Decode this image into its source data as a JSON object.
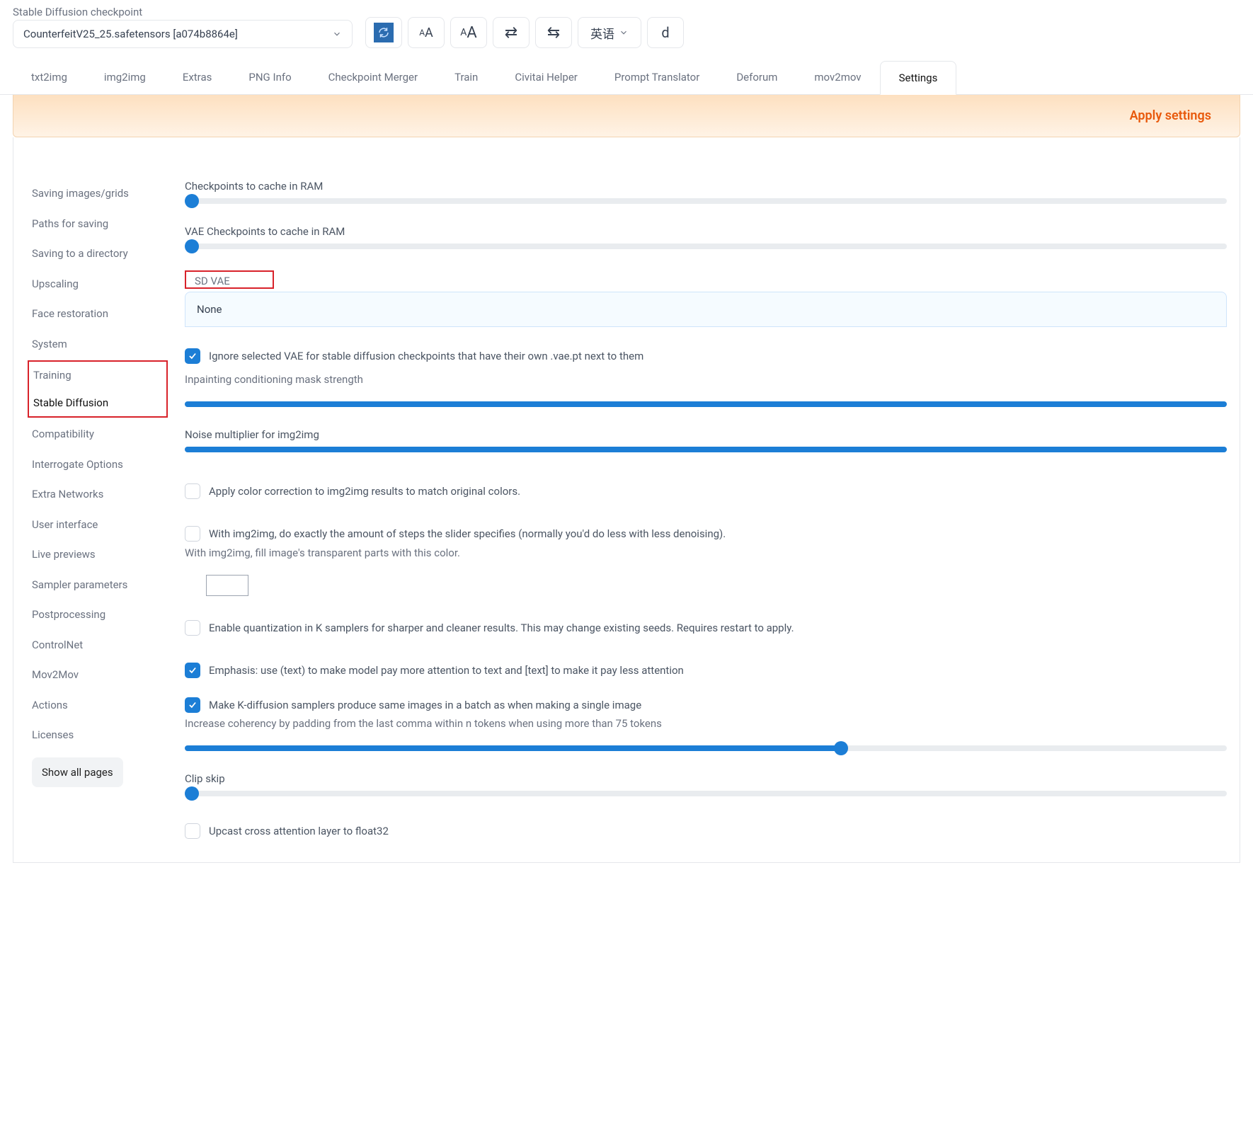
{
  "header": {
    "checkpoint_label": "Stable Diffusion checkpoint",
    "checkpoint_value": "CounterfeitV25_25.safetensors [a074b8864e]",
    "toolbar": {
      "refresh": "refresh",
      "font_small": "ᴀA",
      "font_large": "ᴀA",
      "swap": "⇄",
      "translate_toggle": "⇆",
      "language": "英语",
      "d": "d"
    }
  },
  "tabs": [
    "txt2img",
    "img2img",
    "Extras",
    "PNG Info",
    "Checkpoint Merger",
    "Train",
    "Civitai Helper",
    "Prompt Translator",
    "Deforum",
    "mov2mov",
    "Settings"
  ],
  "active_tab": "Settings",
  "apply_button": "Apply settings",
  "sidebar": {
    "items": [
      "Saving images/grids",
      "Paths for saving",
      "Saving to a directory",
      "Upscaling",
      "Face restoration",
      "System",
      "Training",
      "Stable Diffusion",
      "Compatibility",
      "Interrogate Options",
      "Extra Networks",
      "User interface",
      "Live previews",
      "Sampler parameters",
      "Postprocessing",
      "ControlNet",
      "Mov2Mov",
      "Actions",
      "Licenses"
    ],
    "active_index": 7,
    "show_all": "Show all pages"
  },
  "settings": {
    "ckpt_cache_label": "Checkpoints to cache in RAM",
    "ckpt_cache_fill_pct": 0,
    "vae_cache_label": "VAE Checkpoints to cache in RAM",
    "vae_cache_fill_pct": 0,
    "sd_vae_label": "SD VAE",
    "sd_vae_value": "None",
    "ignore_vae": {
      "checked": true,
      "label": "Ignore selected VAE for stable diffusion checkpoints that have their own .vae.pt next to them"
    },
    "inpaint_mask_label": "Inpainting conditioning mask strength",
    "inpaint_mask_fill_pct": 100,
    "noise_mult_label": "Noise multiplier for img2img",
    "noise_mult_fill_pct": 100,
    "color_corr": {
      "checked": false,
      "label": "Apply color correction to img2img results to match original colors."
    },
    "exact_steps": {
      "checked": false,
      "label": "With img2img, do exactly the amount of steps the slider specifies (normally you'd do less with less denoising)."
    },
    "fill_color_note": "With img2img, fill image's transparent parts with this color.",
    "quantization": {
      "checked": false,
      "label": "Enable quantization in K samplers for sharper and cleaner results. This may change existing seeds. Requires restart to apply."
    },
    "emphasis": {
      "checked": true,
      "label": "Emphasis: use (text) to make model pay more attention to text and [text] to make it pay less attention"
    },
    "batch_same": {
      "checked": true,
      "label": "Make K-diffusion samplers produce same images in a batch as when making a single image"
    },
    "coherency_label": "Increase coherency by padding from the last comma within n tokens when using more than 75 tokens",
    "coherency_fill_pct": 63,
    "clip_skip_label": "Clip skip",
    "clip_skip_fill_pct": 0,
    "upcast": {
      "checked": false,
      "label": "Upcast cross attention layer to float32"
    }
  }
}
